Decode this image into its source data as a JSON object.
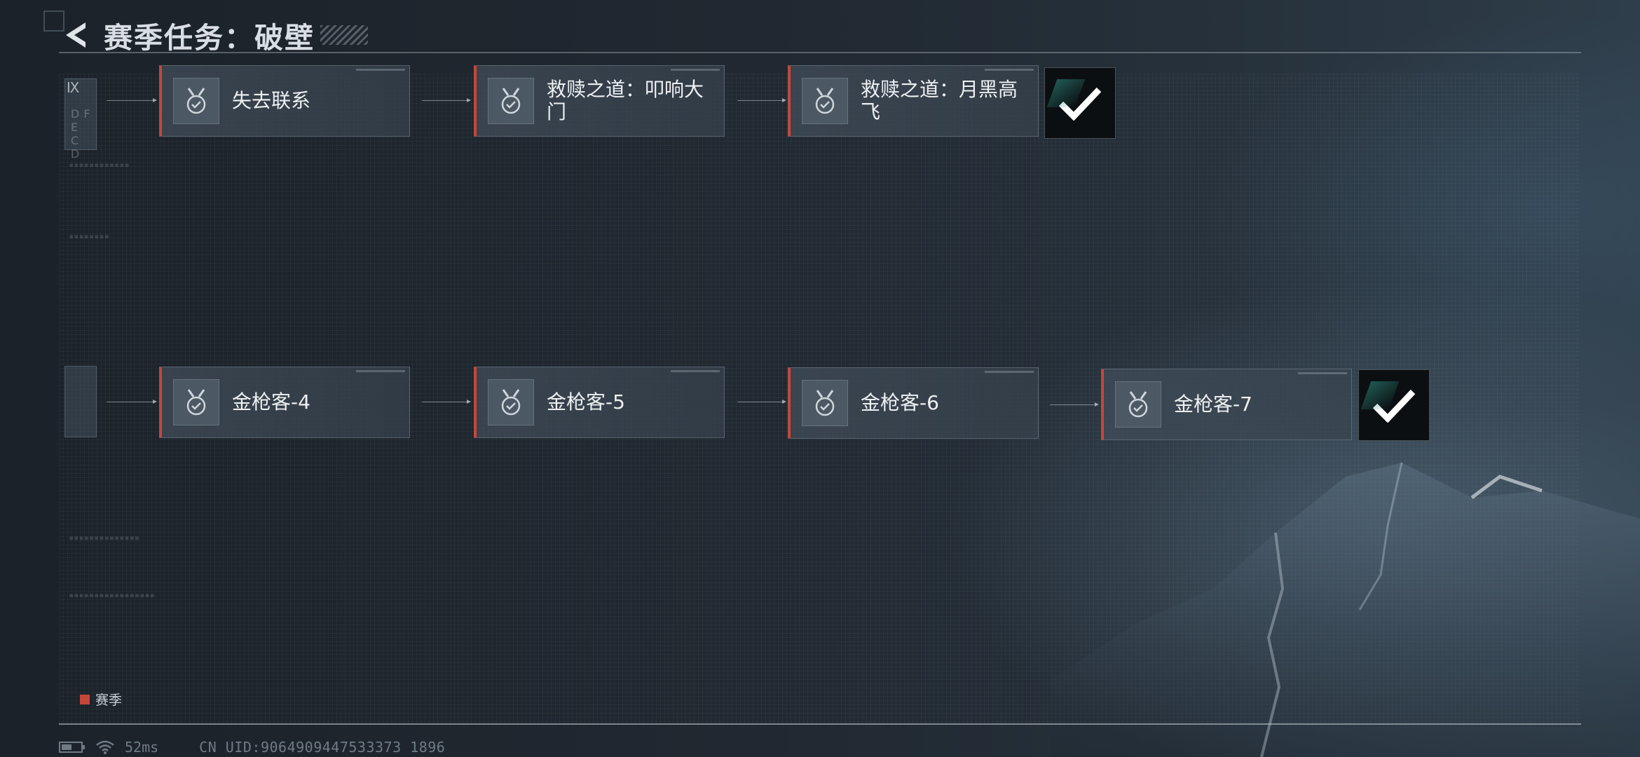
{
  "header": {
    "title": "赛季任务：破壁"
  },
  "rows": [
    {
      "stub_text": "DF E C D",
      "stub_mark": "Ⅸ",
      "nodes": [
        {
          "label": "失去联系"
        },
        {
          "label": "救赎之道：叩响大门"
        },
        {
          "label": "救赎之道：月黑高飞"
        }
      ],
      "completed": true
    },
    {
      "nodes": [
        {
          "label": "金枪客-4"
        },
        {
          "label": "金枪客-5"
        },
        {
          "label": "金枪客-6"
        },
        {
          "label": "金枪客-7"
        }
      ],
      "completed": true
    }
  ],
  "legend": {
    "label": "赛季",
    "color": "#c5473a"
  },
  "status": {
    "ping": "52ms",
    "uid": "CN UID:9064909447533373 1896"
  },
  "colors": {
    "accent": "#c5473a",
    "background": "#1f2730"
  }
}
